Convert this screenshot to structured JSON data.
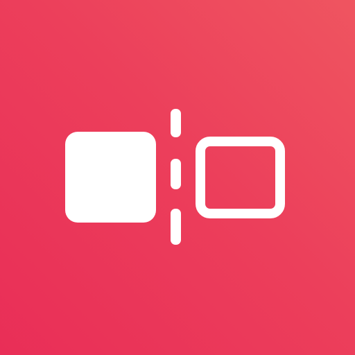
{
  "icon": {
    "name": "compare-before-after-icon",
    "colors": {
      "background_start": "#ef5560",
      "background_end": "#e92e57",
      "foreground": "#ffffff"
    }
  }
}
